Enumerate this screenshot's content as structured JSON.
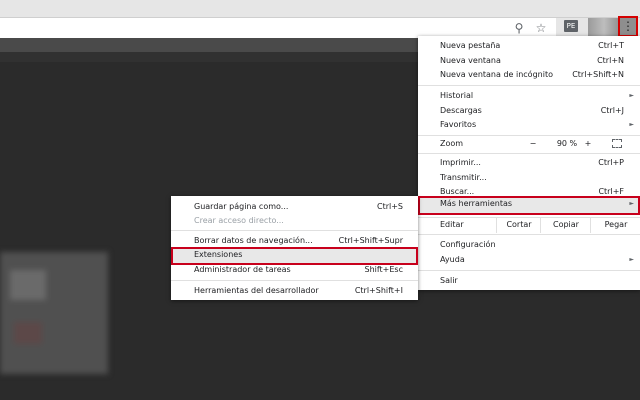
{
  "toolbar": {
    "ext_badge": "PE",
    "menu_dots": "⋮",
    "zoom_glyph": "⚲",
    "star_glyph": "☆"
  },
  "main_menu": {
    "new_tab": {
      "label": "Nueva pestaña",
      "shortcut": "Ctrl+T"
    },
    "new_window": {
      "label": "Nueva ventana",
      "shortcut": "Ctrl+N"
    },
    "incognito": {
      "label": "Nueva ventana de incógnito",
      "shortcut": "Ctrl+Shift+N"
    },
    "history": {
      "label": "Historial"
    },
    "downloads": {
      "label": "Descargas",
      "shortcut": "Ctrl+J"
    },
    "bookmarks": {
      "label": "Favoritos"
    },
    "zoom": {
      "label": "Zoom",
      "minus": "−",
      "value": "90 %",
      "plus": "+"
    },
    "print": {
      "label": "Imprimir...",
      "shortcut": "Ctrl+P"
    },
    "cast": {
      "label": "Transmitir..."
    },
    "find": {
      "label": "Buscar...",
      "shortcut": "Ctrl+F"
    },
    "more_tools": {
      "label": "Más herramientas"
    },
    "edit": {
      "label": "Editar",
      "cut": "Cortar",
      "copy": "Copiar",
      "paste": "Pegar"
    },
    "settings": {
      "label": "Configuración"
    },
    "help": {
      "label": "Ayuda"
    },
    "exit": {
      "label": "Salir"
    },
    "arrow": "►"
  },
  "sub_menu": {
    "save_page": {
      "label": "Guardar página como...",
      "shortcut": "Ctrl+S"
    },
    "create_shortcut": {
      "label": "Crear acceso directo..."
    },
    "clear_data": {
      "label": "Borrar datos de navegación...",
      "shortcut": "Ctrl+Shift+Supr"
    },
    "extensions": {
      "label": "Extensiones"
    },
    "task_manager": {
      "label": "Administrador de tareas",
      "shortcut": "Shift+Esc"
    },
    "dev_tools": {
      "label": "Herramientas del desarrollador",
      "shortcut": "Ctrl+Shift+I"
    }
  },
  "colors": {
    "highlight_border": "#c8001c",
    "menu_bg": "#ffffff",
    "page_bg": "#2b2b2b"
  }
}
